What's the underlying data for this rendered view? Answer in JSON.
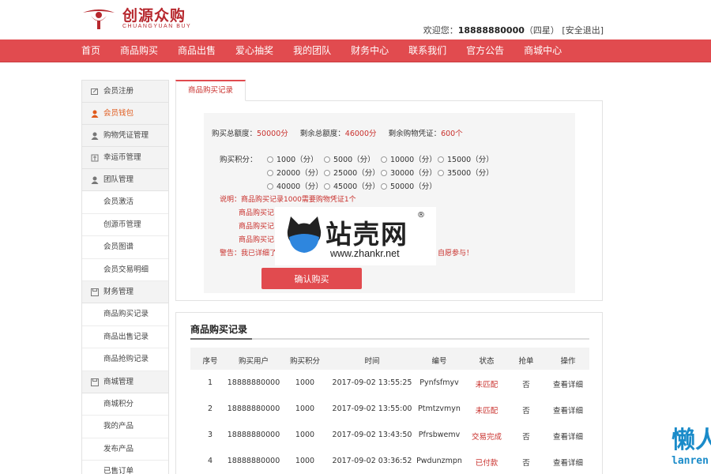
{
  "brand": {
    "name_cn": "创源众购",
    "name_en": "CHUANGYUAN BUY",
    "color": "#b7282e"
  },
  "userbar": {
    "welcome": "欢迎您：",
    "phone": "18888880000",
    "level": "（四星）",
    "links": "[安全退出]"
  },
  "nav": {
    "color": "#e14b4f",
    "items": [
      "首页",
      "商品购买",
      "商品出售",
      "爱心抽奖",
      "我的团队",
      "财务中心",
      "联系我们",
      "官方公告",
      "商城中心"
    ]
  },
  "sidebar": {
    "c0": {
      "label": "会员注册",
      "icon": "edit-icon"
    },
    "c1": {
      "label": "会员钱包",
      "icon": "user-icon"
    },
    "c2": {
      "label": "购物凭证管理",
      "icon": "user-icon"
    },
    "c3": {
      "label": "幸运币管理",
      "icon": "coin-icon"
    },
    "c4": {
      "label": "团队管理",
      "icon": "user-icon"
    },
    "s4": [
      "会员激活",
      "创源币管理",
      "会员图谱",
      "会员交易明细"
    ],
    "c5": {
      "label": "财务管理",
      "icon": "save-icon"
    },
    "s5": [
      "商品购买记录",
      "商品出售记录",
      "商品抢购记录"
    ],
    "c6": {
      "label": "商城管理",
      "icon": "save-icon"
    },
    "s6": [
      "商城积分",
      "我的产品",
      "发布产品",
      "已售订单"
    ]
  },
  "tab": {
    "label": "商品购买记录"
  },
  "form": {
    "total_label": "购买总额度：",
    "total_value": "50000分",
    "remain_label": "剩余总额度：",
    "remain_value": "46000分",
    "voucher_label": "剩余购物凭证：",
    "voucher_value": "600个",
    "points_label": "购买积分：",
    "options": [
      "1000（分）",
      "5000（分）",
      "10000（分）",
      "15000（分）",
      "20000（分）",
      "25000（分）",
      "30000（分）",
      "35000（分）",
      "40000（分）",
      "45000（分）",
      "50000（分）"
    ],
    "note_1": "说明：商品购买记录1000需要购物凭证1个",
    "note_2": "商品购买记",
    "note_3": "商品购买记",
    "note_4": "商品购买记",
    "warn_left": "警告：我已详细了",
    "warn_right": "自愿参与！",
    "confirm": "确认购买"
  },
  "watermark": {
    "text": "站壳网",
    "url": "www.zhankr.net",
    "reg": "®"
  },
  "records": {
    "title": "商品购买记录",
    "headers": [
      "序号",
      "购买用户",
      "购买积分",
      "时间",
      "编号",
      "状态",
      "抢单",
      "操作"
    ],
    "rows": [
      [
        "1",
        "18888880000",
        "1000",
        "2017-09-02 13:55:25",
        "Pynfsfmyv",
        "未匹配",
        "否",
        "查看详细"
      ],
      [
        "2",
        "18888880000",
        "1000",
        "2017-09-02 13:55:00",
        "Ptmtzvmyn",
        "未匹配",
        "否",
        "查看详细"
      ],
      [
        "3",
        "18888880000",
        "1000",
        "2017-09-02 13:43:50",
        "Pfrsbwemv",
        "交易完成",
        "否",
        "查看详细"
      ],
      [
        "4",
        "18888880000",
        "1000",
        "2017-09-02 03:36:52",
        "Pwdunzmpn",
        "已付款",
        "否",
        "查看详细"
      ]
    ]
  },
  "corner": {
    "cn": "懒人",
    "en": "lanren"
  }
}
